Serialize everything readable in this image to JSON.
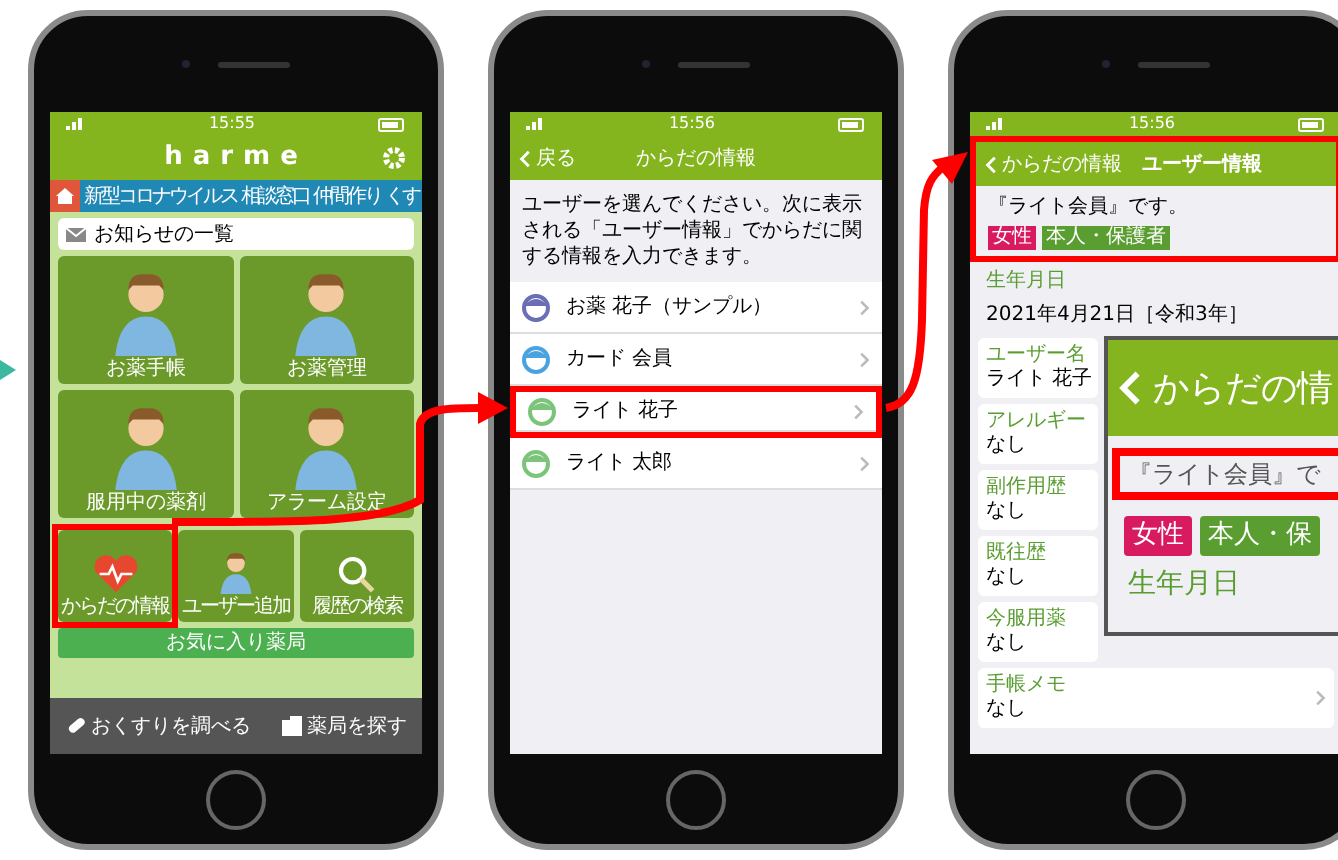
{
  "phones": [
    {
      "kind": "home",
      "time": "15:55",
      "app_title": "harme",
      "tabs": [
        {
          "label": "新型コロナウイルス"
        },
        {
          "label": "相談窓口"
        },
        {
          "label": "仲間作り"
        },
        {
          "label": "くす"
        }
      ],
      "notice": "お知らせの一覧",
      "tiles": [
        {
          "label": "お薬手帳",
          "kind": "person",
          "highlighted": false
        },
        {
          "label": "お薬管理",
          "kind": "person",
          "highlighted": false
        },
        {
          "label": "服用中の薬剤",
          "kind": "person",
          "highlighted": false
        },
        {
          "label": "アラーム設定",
          "kind": "person",
          "highlighted": false
        },
        {
          "label": "からだの情報",
          "kind": "heart",
          "highlighted": true
        },
        {
          "label": "ユーザー追加",
          "kind": "person",
          "highlighted": false
        },
        {
          "label": "履歴の検索",
          "kind": "search",
          "highlighted": false
        }
      ],
      "favorite": "お気に入り薬局",
      "bottom": [
        {
          "label": "おくすりを調べる",
          "kind": "pill"
        },
        {
          "label": "薬局を探す",
          "kind": "building"
        }
      ]
    },
    {
      "kind": "list",
      "time": "15:56",
      "back": "戻る",
      "title": "からだの情報",
      "instruction": "ユーザーを選んでください。次に表示される「ユーザー情報」でからだに関する情報を入力できます。",
      "users": [
        {
          "name": "お薬 花子（サンプル）",
          "color": "#6a6fb5",
          "highlighted": false
        },
        {
          "name": "カード 会員",
          "color": "#4aa3df",
          "highlighted": false
        },
        {
          "name": "ライト 花子",
          "color": "#7cc47a",
          "highlighted": true
        },
        {
          "name": "ライト 太郎",
          "color": "#7cc47a",
          "highlighted": false
        }
      ]
    },
    {
      "kind": "detail",
      "time": "15:56",
      "highlighted": true,
      "back": "からだの情報",
      "title": "ユーザー情報",
      "member": "『ライト会員』です。",
      "tags": [
        {
          "label": "女性",
          "color": "#d81b60"
        },
        {
          "label": "本人・保護者",
          "color": "#5a9e32"
        }
      ],
      "birth_label": "生年月日",
      "birth": "2021年4月21日［令和3年］",
      "fields": [
        {
          "label": "ユーザー名",
          "value": "ライト 花子"
        },
        {
          "label": "アレルギー",
          "value": "なし"
        },
        {
          "label": "副作用歴",
          "value": "なし"
        },
        {
          "label": "既往歴",
          "value": "なし"
        },
        {
          "label": "今服用薬",
          "value": "なし"
        },
        {
          "label": "手帳メモ",
          "value": "なし"
        }
      ]
    }
  ],
  "inset": {
    "title": "からだの情",
    "member": "『ライト会員』で",
    "tags": [
      {
        "label": "女性",
        "color": "#d81b60"
      },
      {
        "label": "本人・保",
        "color": "#5a9e32"
      }
    ],
    "birth_label": "生年月日"
  }
}
